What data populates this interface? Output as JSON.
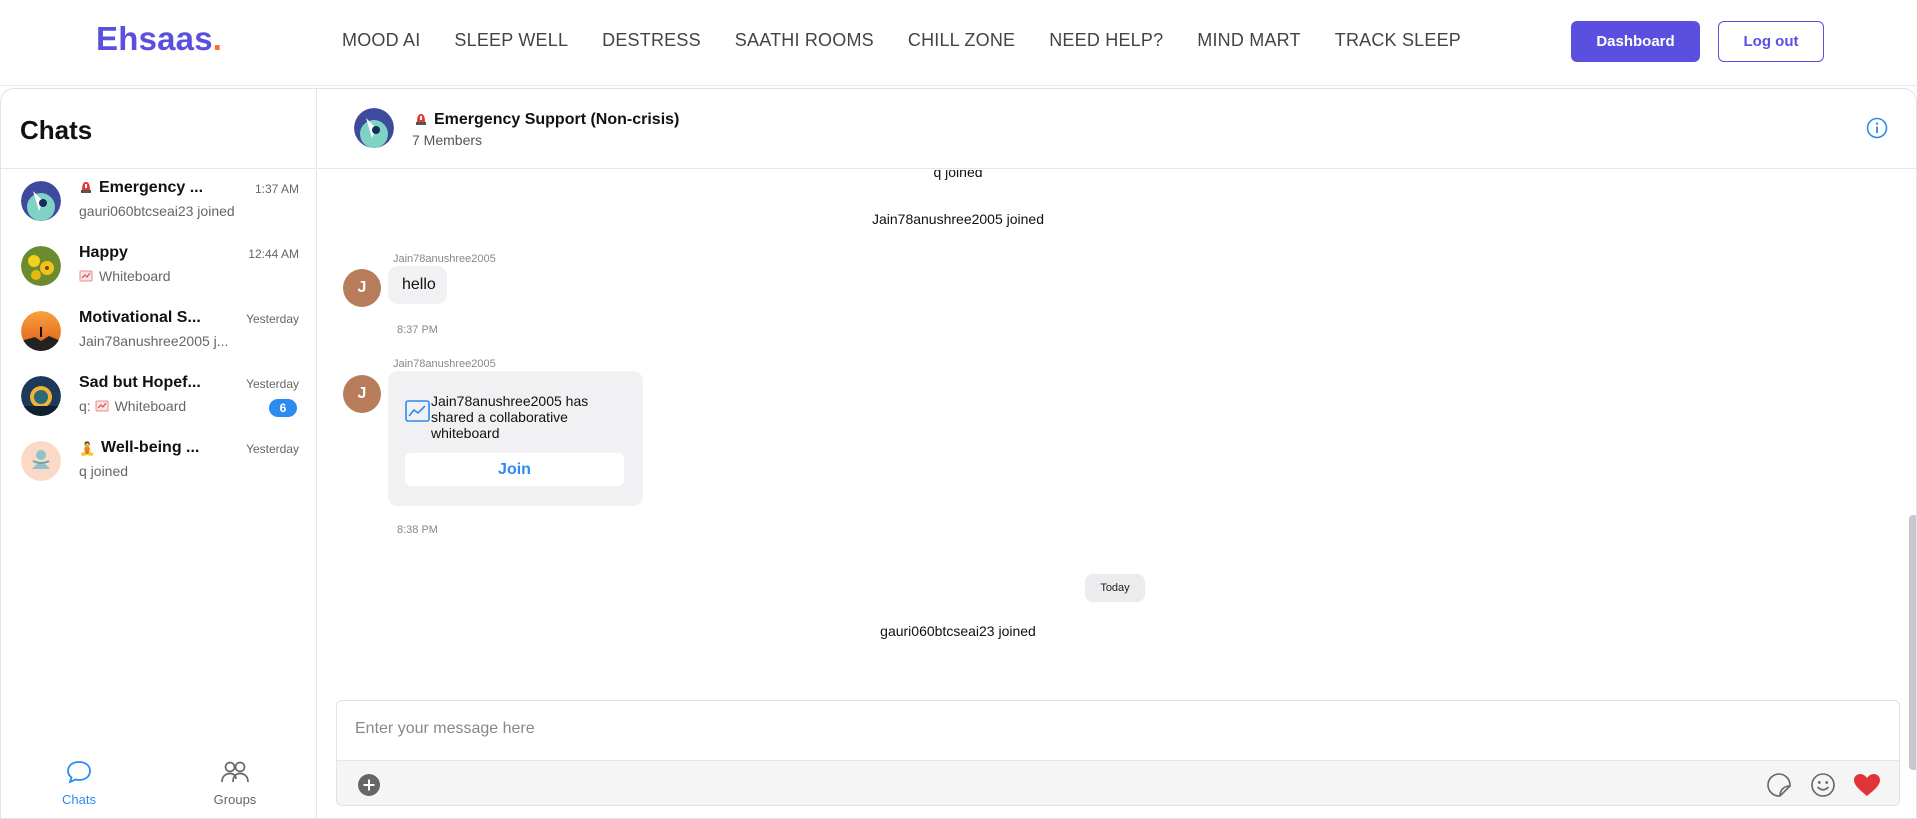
{
  "brand": {
    "name": "Ehsaas",
    "dot": ".",
    "color": "#5b4fe0",
    "dot_color": "#ff6b35"
  },
  "nav": {
    "items": [
      "MOOD AI",
      "SLEEP WELL",
      "DESTRESS",
      "SAATHI ROOMS",
      "CHILL ZONE",
      "NEED HELP?",
      "MIND MART",
      "TRACK SLEEP"
    ]
  },
  "header_actions": {
    "dashboard": "Dashboard",
    "logout": "Log out"
  },
  "sidebar": {
    "title": "Chats",
    "chats": [
      {
        "name": "Emergency ...",
        "icon": "siren-emoji",
        "time": "1:37 AM",
        "preview": "gauri060btcseai23 joined",
        "badge": ""
      },
      {
        "name": "Happy",
        "icon": "",
        "time": "12:44 AM",
        "preview_icon": "whiteboard-icon",
        "preview": "Whiteboard",
        "badge": ""
      },
      {
        "name": "Motivational S...",
        "icon": "",
        "time": "Yesterday",
        "preview": "Jain78anushree2005 j...",
        "badge": ""
      },
      {
        "name": "Sad but Hopef...",
        "icon": "",
        "time": "Yesterday",
        "preview_prefix": "q:",
        "preview_icon": "whiteboard-icon",
        "preview": "Whiteboard",
        "badge": "6"
      },
      {
        "name": "Well-being ...",
        "icon": "meditation-emoji",
        "time": "Yesterday",
        "preview": "q joined",
        "badge": ""
      }
    ],
    "tabs": [
      {
        "label": "Chats",
        "icon": "chat-bubble-icon",
        "active": true
      },
      {
        "label": "Groups",
        "icon": "groups-icon",
        "active": false
      }
    ]
  },
  "chat": {
    "title": "Emergency Support (Non-crisis)",
    "title_icon": "siren-emoji",
    "members": "7 Members",
    "messages": {
      "sys1": "q joined",
      "sys2": "Jain78anushree2005 joined",
      "msg1": {
        "sender": "Jain78anushree2005",
        "avatar": "J",
        "text": "hello",
        "time": "8:37 PM"
      },
      "msg2": {
        "sender": "Jain78anushree2005",
        "avatar": "J",
        "card_text": "Jain78anushree2005 has shared a collaborative whiteboard",
        "join_label": "Join",
        "time": "8:38 PM"
      },
      "day_divider": "Today",
      "sys3": "gauri060btcseai23 joined"
    },
    "composer": {
      "placeholder": "Enter your message here"
    }
  },
  "colors": {
    "accent": "#2b8bf0",
    "avatar_bg": "#b97c5a",
    "heart": "#e0343a"
  }
}
